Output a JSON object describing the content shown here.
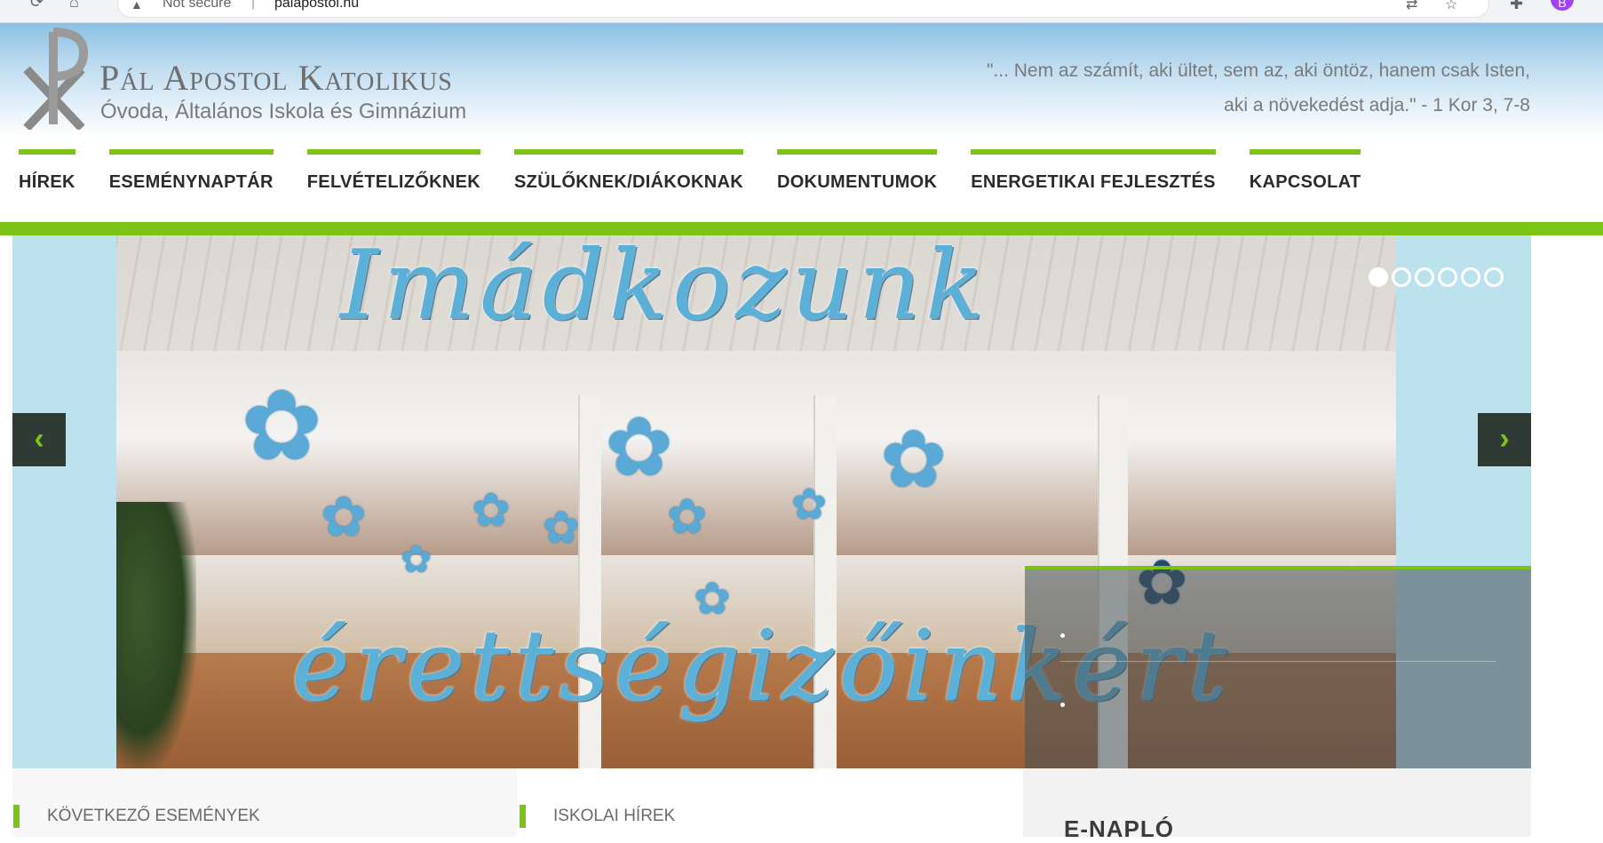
{
  "browser": {
    "security_label": "Not secure",
    "url": "palapostol.hu",
    "profile_initial": "B"
  },
  "site": {
    "title": "Pál Apostol Katolikus",
    "subtitle": "Óvoda, Általános Iskola és Gimnázium",
    "quote_line1": "\"... Nem az számít, aki ültet, sem az, aki öntöz, hanem csak Isten,",
    "quote_line2": "aki a növekedést adja.\" - 1 Kor 3, 7-8"
  },
  "nav": {
    "items": [
      {
        "label": "HÍREK"
      },
      {
        "label": "ESEMÉNYNAPTÁR"
      },
      {
        "label": "FELVÉTELIZŐKNEK"
      },
      {
        "label": "SZÜLŐKNEK/DIÁKOKNAK"
      },
      {
        "label": "DOKUMENTUMOK"
      },
      {
        "label": "ENERGETIKAI FEJLESZTÉS"
      },
      {
        "label": "KAPCSOLAT"
      }
    ]
  },
  "slider": {
    "headline_top": "Imádkozunk",
    "headline_bottom": "érettségizőinkért",
    "prev_glyph": "‹",
    "next_glyph": "›",
    "slide_count": 6,
    "active_slide": 1
  },
  "sections": {
    "events_title": "KÖVETKEZŐ ESEMÉNYEK",
    "news_title": "ISKOLAI HÍREK",
    "enaplo_title": "E-NAPLÓ"
  },
  "colors": {
    "accent_green": "#7cc318",
    "headline_blue": "#5bb0d8",
    "slider_bg": "#bce2ee",
    "arrow_bg": "#2e3a33"
  },
  "icons": {
    "back": "back-icon",
    "reload": "reload-icon",
    "home": "home-icon",
    "logo": "chi-rho-logo-icon",
    "prev": "chevron-left-icon",
    "next": "chevron-right-icon"
  }
}
